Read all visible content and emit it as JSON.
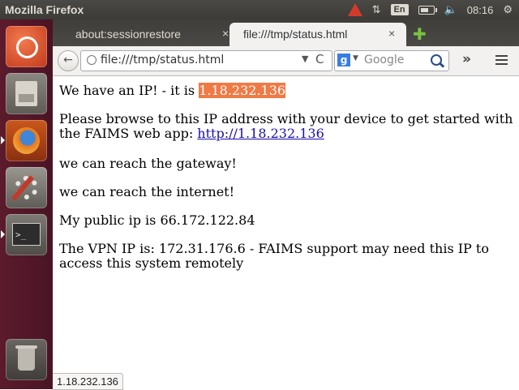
{
  "panel": {
    "app_title": "Mozilla Firefox",
    "language": "En",
    "clock": "08:16"
  },
  "tabs": [
    {
      "label": "about:sessionrestore",
      "close": "×"
    },
    {
      "label": "file:///tmp/status.html",
      "close": "×"
    }
  ],
  "nav": {
    "back": "←",
    "url": "file:///tmp/status.html",
    "url_dropdown": "▼",
    "reload": "C",
    "search_engine": "g",
    "search_dropdown": "▼",
    "search_placeholder": "Google",
    "overflow": "»"
  },
  "content": {
    "ip_prefix": "We have an IP! - it is ",
    "ip": "1.18.232.136",
    "browse_text": "Please browse to this IP address with your device to get started with the FAIMS web app: ",
    "browse_link": "http://1.18.232.136",
    "gateway": "we can reach the gateway!",
    "internet": "we can reach the internet!",
    "public_ip": "My public ip is 66.172.122.84",
    "vpn": "The VPN IP is: 172.31.176.6 - FAIMS support may need this IP to access this system remotely"
  },
  "status_bar": "1.18.232.136",
  "colors": {
    "ip_highlight": "#ef7a45",
    "launcher": "#5b1b2d"
  }
}
